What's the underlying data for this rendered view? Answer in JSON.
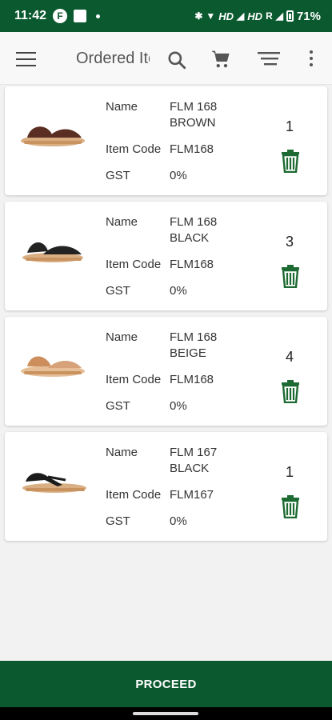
{
  "status_bar": {
    "time": "11:42",
    "f_badge": "F",
    "indicators": "HD",
    "indicators2": "HD",
    "roaming": "R",
    "battery": "71%"
  },
  "app_bar": {
    "title": "Ordered Ite"
  },
  "labels": {
    "name": "Name",
    "item_code": "Item Code",
    "gst": "GST"
  },
  "items": [
    {
      "name": "FLM 168 BROWN",
      "item_code": "FLM168",
      "gst": "0%",
      "quantity": "1",
      "color": "#5a2e22"
    },
    {
      "name": "FLM 168 BLACK",
      "item_code": "FLM168",
      "gst": "0%",
      "quantity": "3",
      "color": "#222222"
    },
    {
      "name": "FLM 168 BEIGE",
      "item_code": "FLM168",
      "gst": "0%",
      "quantity": "4",
      "color": "#d7a27a"
    },
    {
      "name": "FLM 167 BLACK",
      "item_code": "FLM167",
      "gst": "0%",
      "quantity": "1",
      "color": "#1b1b1b"
    }
  ],
  "footer": {
    "proceed_label": "PROCEED"
  },
  "colors": {
    "brand": "#0b5a2f"
  }
}
